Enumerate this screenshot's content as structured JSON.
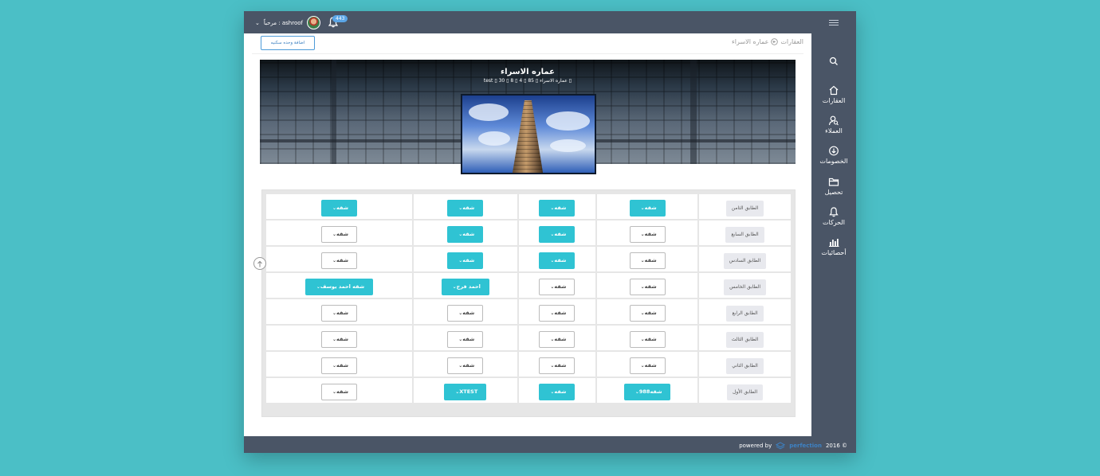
{
  "topbar": {
    "greeting": "مرحباً : ashroof",
    "notifications_count": "443"
  },
  "sidebar": {
    "items": [
      {
        "label": "العقارات",
        "icon": "home-icon"
      },
      {
        "label": "العملاء",
        "icon": "user-search-icon"
      },
      {
        "label": "الخصومات",
        "icon": "download-circle-icon"
      },
      {
        "label": "تحصيل",
        "icon": "folder-icon"
      },
      {
        "label": "الحركات",
        "icon": "bell-icon"
      },
      {
        "label": "أحصائيات",
        "icon": "bar-chart-icon"
      }
    ]
  },
  "header": {
    "add_button": "اضافة وحده سكنيه",
    "breadcrumb_root": "العقارات",
    "breadcrumb_current": "عماره الاسراء"
  },
  "banner": {
    "title": "عماره الاسراء",
    "meta": [
      "85",
      "عماره الاسراء",
      "4",
      "8",
      "30",
      "test"
    ]
  },
  "floors": [
    {
      "label": "الطابق الثامن",
      "units": [
        {
          "text": "شقه",
          "active": true
        },
        {
          "text": "شقه",
          "active": true
        },
        {
          "text": "شقه",
          "active": true
        },
        {
          "text": "شقه",
          "active": true
        }
      ]
    },
    {
      "label": "الطابق السابع",
      "units": [
        {
          "text": "شقه",
          "active": false
        },
        {
          "text": "شقه",
          "active": true
        },
        {
          "text": "شقه",
          "active": true
        },
        {
          "text": "شقه",
          "active": false
        }
      ]
    },
    {
      "label": "الطابق السادس",
      "units": [
        {
          "text": "شقه",
          "active": false
        },
        {
          "text": "شقه",
          "active": true
        },
        {
          "text": "شقه",
          "active": true
        },
        {
          "text": "شقه",
          "active": false
        }
      ]
    },
    {
      "label": "الطابق الخامس",
      "units": [
        {
          "text": "شقه احمد يوسف",
          "active": true
        },
        {
          "text": "احمد فرج",
          "active": true
        },
        {
          "text": "شقه",
          "active": false
        },
        {
          "text": "شقه",
          "active": false
        }
      ]
    },
    {
      "label": "الطابق الرابع",
      "units": [
        {
          "text": "شقه",
          "active": false
        },
        {
          "text": "شقه",
          "active": false
        },
        {
          "text": "شقه",
          "active": false
        },
        {
          "text": "شقه",
          "active": false
        }
      ]
    },
    {
      "label": "الطابق الثالث",
      "units": [
        {
          "text": "شقه",
          "active": false
        },
        {
          "text": "شقه",
          "active": false
        },
        {
          "text": "شقه",
          "active": false
        },
        {
          "text": "شقه",
          "active": false
        }
      ]
    },
    {
      "label": "الطابق الثاني",
      "units": [
        {
          "text": "شقه",
          "active": false
        },
        {
          "text": "شقه",
          "active": false
        },
        {
          "text": "شقه",
          "active": false
        },
        {
          "text": "شقه",
          "active": false
        }
      ]
    },
    {
      "label": "الطابق الأول",
      "units": [
        {
          "text": "شقه",
          "active": false
        },
        {
          "text": "XTEST",
          "active": true
        },
        {
          "text": "شقه",
          "active": true
        },
        {
          "text": "شقه988",
          "active": true
        }
      ]
    }
  ],
  "footer": {
    "powered_by": "powered by",
    "brand": "perfection",
    "copyright": "2016 ©"
  },
  "colors": {
    "accent": "#2fc3d3",
    "chrome": "#4a5566",
    "background": "#4bbfc6"
  }
}
